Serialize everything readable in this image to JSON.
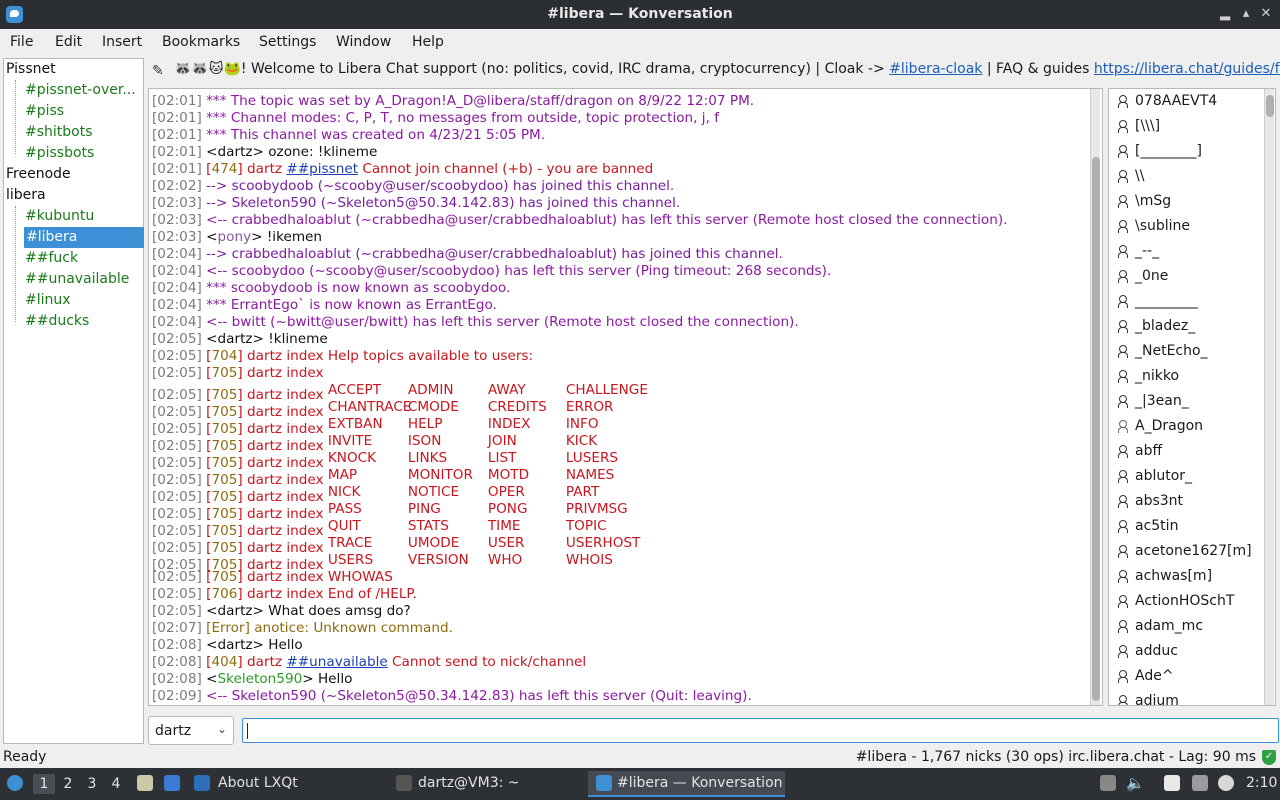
{
  "window": {
    "title": "#libera — Konversation"
  },
  "menubar": [
    "File",
    "Edit",
    "Insert",
    "Bookmarks",
    "Settings",
    "Window",
    "Help"
  ],
  "topic": {
    "prefix": "! Welcome to Libera Chat support (no: politics, covid, IRC drama, cryptocurrency) | Cloak -> ",
    "emoji": "🦝🦝🐱🐸",
    "link1": "#libera-cloak",
    "middle": " | FAQ & guides ",
    "link2": "https://libera.chat/guides/fa..."
  },
  "servers": [
    {
      "name": "Pissnet",
      "channels": [
        "#pissnet-over...",
        "#piss",
        "#shitbots",
        "#pissbots"
      ]
    },
    {
      "name": "Freenode",
      "channels": []
    },
    {
      "name": "libera",
      "channels": [
        "#kubuntu",
        "#libera",
        "##fuck",
        "##unavailable",
        "#linux",
        "##ducks"
      ]
    }
  ],
  "selected_channel": "#libera",
  "messages": [
    {
      "ts": "[02:01]",
      "kind": "info",
      "text": "*** The topic was set by A_Dragon!A_D@libera/staff/dragon on 8/9/22 12:07 PM."
    },
    {
      "ts": "[02:01]",
      "kind": "info",
      "text": "*** Channel modes: C, P, T, no messages from outside, topic protection, j, f"
    },
    {
      "ts": "[02:01]",
      "kind": "info",
      "text": "*** This channel was created on 4/23/21 5:05 PM."
    },
    {
      "ts": "[02:01]",
      "kind": "msg",
      "nick": "dartz",
      "text": " ozone: !klineme"
    },
    {
      "ts": "[02:01]",
      "kind": "numeric",
      "num": "474",
      "pre": " dartz ",
      "link": "##pissnet",
      "text": " Cannot join channel (+b) - you are banned"
    },
    {
      "ts": "[02:02]",
      "kind": "join",
      "text": "--> scoobydoob (~scooby@user/scoobydoo) has joined this channel."
    },
    {
      "ts": "[02:03]",
      "kind": "join",
      "text": "--> Skeleton590 (~Skeleton5@50.34.142.83) has joined this channel."
    },
    {
      "ts": "[02:03]",
      "kind": "quit",
      "text": "<-- crabbedhaloablut (~crabbedha@user/crabbedhaloablut) has left this server (Remote host closed the connection)."
    },
    {
      "ts": "[02:03]",
      "kind": "msg",
      "nick": "pony",
      "nickclass": "nick-pony",
      "text": " !ikemen"
    },
    {
      "ts": "[02:04]",
      "kind": "join",
      "text": "--> crabbedhaloablut (~crabbedha@user/crabbedhaloablut) has joined this channel."
    },
    {
      "ts": "[02:04]",
      "kind": "quit",
      "text": "<-- scoobydoo (~scooby@user/scoobydoo) has left this server (Ping timeout: 268 seconds)."
    },
    {
      "ts": "[02:04]",
      "kind": "info",
      "text": "*** scoobydoob is now known as scoobydoo."
    },
    {
      "ts": "[02:04]",
      "kind": "info",
      "text": "*** ErrantEgo` is now known as ErrantEgo."
    },
    {
      "ts": "[02:04]",
      "kind": "quit",
      "text": "<-- bwitt (~bwitt@user/bwitt) has left this server (Remote host closed the connection)."
    },
    {
      "ts": "[02:05]",
      "kind": "msg",
      "nick": "dartz",
      "text": " !klineme"
    },
    {
      "ts": "[02:05]",
      "kind": "numeric",
      "num": "704",
      "pre": " dartz index Help topics available to users:"
    },
    {
      "ts": "[02:05]",
      "kind": "numeric",
      "num": "705",
      "pre": " dartz index"
    },
    {
      "ts": "[02:05]",
      "kind": "numeric",
      "num": "705",
      "pre": " dartz index ",
      "cols": [
        "ACCEPT",
        "ADMIN",
        "AWAY",
        "CHALLENGE"
      ]
    },
    {
      "ts": "[02:05]",
      "kind": "numeric",
      "num": "705",
      "pre": " dartz index ",
      "cols": [
        "CHANTRACE",
        "CMODE",
        "CREDITS",
        "ERROR"
      ]
    },
    {
      "ts": "[02:05]",
      "kind": "numeric",
      "num": "705",
      "pre": " dartz index ",
      "cols": [
        "EXTBAN",
        "HELP",
        "INDEX",
        "INFO"
      ]
    },
    {
      "ts": "[02:05]",
      "kind": "numeric",
      "num": "705",
      "pre": " dartz index ",
      "cols": [
        "INVITE",
        "ISON",
        "JOIN",
        "KICK"
      ]
    },
    {
      "ts": "[02:05]",
      "kind": "numeric",
      "num": "705",
      "pre": " dartz index ",
      "cols": [
        "KNOCK",
        "LINKS",
        "LIST",
        "LUSERS"
      ]
    },
    {
      "ts": "[02:05]",
      "kind": "numeric",
      "num": "705",
      "pre": " dartz index ",
      "cols": [
        "MAP",
        "MONITOR",
        "MOTD",
        "NAMES"
      ]
    },
    {
      "ts": "[02:05]",
      "kind": "numeric",
      "num": "705",
      "pre": " dartz index ",
      "cols": [
        "NICK",
        "NOTICE",
        "OPER",
        "PART"
      ]
    },
    {
      "ts": "[02:05]",
      "kind": "numeric",
      "num": "705",
      "pre": " dartz index ",
      "cols": [
        "PASS",
        "PING",
        "PONG",
        "PRIVMSG"
      ]
    },
    {
      "ts": "[02:05]",
      "kind": "numeric",
      "num": "705",
      "pre": " dartz index ",
      "cols": [
        "QUIT",
        "STATS",
        "TIME",
        "TOPIC"
      ]
    },
    {
      "ts": "[02:05]",
      "kind": "numeric",
      "num": "705",
      "pre": " dartz index ",
      "cols": [
        "TRACE",
        "UMODE",
        "USER",
        "USERHOST"
      ]
    },
    {
      "ts": "[02:05]",
      "kind": "numeric",
      "num": "705",
      "pre": " dartz index ",
      "cols": [
        "USERS",
        "VERSION",
        "WHO",
        "WHOIS"
      ]
    },
    {
      "ts": "[02:05]",
      "kind": "numeric",
      "num": "705",
      "pre": " dartz index WHOWAS"
    },
    {
      "ts": "[02:05]",
      "kind": "numeric",
      "num": "706",
      "pre": " dartz index End of /HELP."
    },
    {
      "ts": "[02:05]",
      "kind": "msg",
      "nick": "dartz",
      "text": " What does amsg do?"
    },
    {
      "ts": "[02:07]",
      "kind": "error",
      "num": "Error",
      "pre": " anotice: Unknown command."
    },
    {
      "ts": "[02:08]",
      "kind": "msg",
      "nick": "dartz",
      "text": " Hello"
    },
    {
      "ts": "[02:08]",
      "kind": "numeric",
      "num": "404",
      "pre": " dartz ",
      "link": "##unavailable",
      "text": " Cannot send to nick/channel"
    },
    {
      "ts": "[02:08]",
      "kind": "msg",
      "nick": "Skeleton590",
      "nickclass": "nick-sk",
      "text": " Hello"
    },
    {
      "ts": "[02:09]",
      "kind": "quit",
      "text": "<-- Skeleton590 (~Skeleton5@50.34.142.83) has left this server (Quit: leaving)."
    }
  ],
  "nicks": [
    {
      "name": "078AAEVT4"
    },
    {
      "name": "[\\\\\\]"
    },
    {
      "name": "[________]"
    },
    {
      "name": "\\\\"
    },
    {
      "name": "\\mSg"
    },
    {
      "name": "\\subline"
    },
    {
      "name": "_--_"
    },
    {
      "name": "_0ne"
    },
    {
      "name": "_________"
    },
    {
      "name": "_bladez_"
    },
    {
      "name": "_NetEcho_"
    },
    {
      "name": "_nikko"
    },
    {
      "name": "_|3ean_"
    },
    {
      "name": "A_Dragon",
      "op": true
    },
    {
      "name": "abff"
    },
    {
      "name": "ablutor_"
    },
    {
      "name": "abs3nt"
    },
    {
      "name": "ac5tin"
    },
    {
      "name": "acetone1627[m]"
    },
    {
      "name": "achwas[m]"
    },
    {
      "name": "ActionHOSchT"
    },
    {
      "name": "adam_mc"
    },
    {
      "name": "adduc"
    },
    {
      "name": "Ade^"
    },
    {
      "name": "adium"
    }
  ],
  "nick_selector": {
    "value": "dartz"
  },
  "input": {
    "value": ""
  },
  "status": {
    "left": "Ready",
    "right": "#libera - 1,767 nicks (30 ops)  irc.libera.chat - Lag: 90 ms"
  },
  "taskbar": {
    "workspaces": [
      "1",
      "2",
      "3",
      "4"
    ],
    "tasks": [
      "About LXQt",
      "dartz@VM3: ~",
      "#libera — Konversation"
    ],
    "clock": "2:10"
  }
}
